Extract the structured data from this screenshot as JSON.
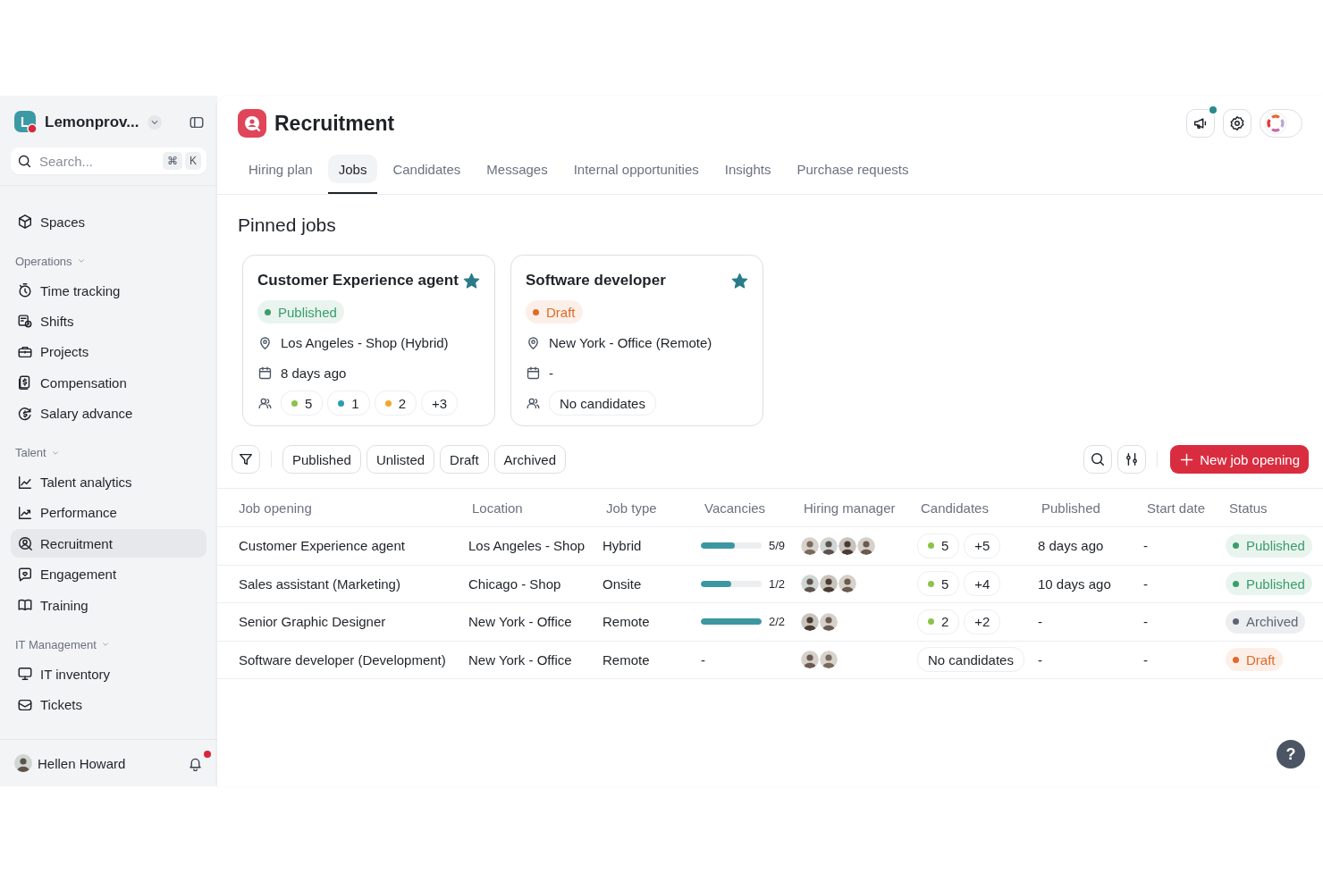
{
  "sidebar": {
    "org": {
      "name": "Lemonprov..."
    },
    "search": {
      "placeholder": "Search...",
      "keys": [
        "⌘",
        "K"
      ]
    },
    "items": [
      {
        "label": "Spaces",
        "selected": false
      }
    ],
    "sections": [
      {
        "title": "Operations",
        "items": [
          {
            "label": "Time tracking",
            "selected": false
          },
          {
            "label": "Shifts",
            "selected": false
          },
          {
            "label": "Projects",
            "selected": false
          },
          {
            "label": "Compensation",
            "selected": false
          },
          {
            "label": "Salary advance",
            "selected": false
          }
        ]
      },
      {
        "title": "Talent",
        "items": [
          {
            "label": "Talent analytics",
            "selected": false
          },
          {
            "label": "Performance",
            "selected": false
          },
          {
            "label": "Recruitment",
            "selected": true
          },
          {
            "label": "Engagement",
            "selected": false
          },
          {
            "label": "Training",
            "selected": false
          }
        ]
      },
      {
        "title": "IT Management",
        "items": [
          {
            "label": "IT inventory",
            "selected": false
          },
          {
            "label": "Tickets",
            "selected": false
          }
        ]
      }
    ],
    "user": {
      "name": "Hellen Howard",
      "has_notification": true
    }
  },
  "header": {
    "title": "Recruitment",
    "announcements_notification": true
  },
  "tabs": [
    {
      "label": "Hiring plan",
      "selected": false
    },
    {
      "label": "Jobs",
      "selected": true
    },
    {
      "label": "Candidates",
      "selected": false
    },
    {
      "label": "Messages",
      "selected": false
    },
    {
      "label": "Internal opportunities",
      "selected": false
    },
    {
      "label": "Insights",
      "selected": false
    },
    {
      "label": "Purchase requests",
      "selected": false
    }
  ],
  "pinned": {
    "title": "Pinned jobs",
    "cards": [
      {
        "title": "Customer Experience agent",
        "pinned": true,
        "status": {
          "label": "Published",
          "color": "#3a9e6a"
        },
        "location": "Los Angeles - Shop (Hybrid)",
        "date": "8 days ago",
        "candidates": [
          {
            "label": "5",
            "color": "#8bc34a"
          },
          {
            "label": "1",
            "color": "#2a9db0"
          },
          {
            "label": "2",
            "color": "#f0a830"
          },
          {
            "label": "+3"
          }
        ]
      },
      {
        "title": "Software developer",
        "pinned": true,
        "status": {
          "label": "Draft",
          "color": "#e06a2a"
        },
        "location": "New York - Office (Remote)",
        "date": "-",
        "candidates": [
          {
            "label": "No candidates"
          }
        ]
      }
    ]
  },
  "filters": [
    "Published",
    "Unlisted",
    "Draft",
    "Archived"
  ],
  "new_job_button": "New job opening",
  "table": {
    "columns": [
      "Job opening",
      "Location",
      "Job type",
      "Vacancies",
      "Hiring manager",
      "Candidates",
      "Published",
      "Start date",
      "Status"
    ],
    "rows": [
      {
        "job": "Customer Experience agent",
        "location": "Los Angeles - Shop",
        "job_type": "Hybrid",
        "vacancies": {
          "level": 0.56,
          "reading": "5/9"
        },
        "managers": [
          {
            "kind": "picture"
          },
          {
            "kind": "picture"
          },
          {
            "kind": "picture"
          },
          {
            "kind": "picture"
          }
        ],
        "candidates": [
          {
            "label": "5",
            "color": "#8bc34a"
          },
          {
            "label": "+5"
          }
        ],
        "published": "8 days ago",
        "start_date": "-",
        "status": {
          "label": "Published",
          "color": "#3a9e6a"
        }
      },
      {
        "job": "Sales assistant (Marketing)",
        "location": "Chicago - Shop",
        "job_type": "Onsite",
        "vacancies": {
          "level": 0.5,
          "reading": "1/2"
        },
        "managers": [
          {
            "kind": "picture"
          },
          {
            "kind": "picture"
          },
          {
            "kind": "picture"
          }
        ],
        "candidates": [
          {
            "label": "5",
            "color": "#8bc34a"
          },
          {
            "label": "+4"
          }
        ],
        "published": "10 days ago",
        "start_date": "-",
        "status": {
          "label": "Published",
          "color": "#3a9e6a"
        }
      },
      {
        "job": "Senior Graphic Designer",
        "location": "New York - Office",
        "job_type": "Remote",
        "vacancies": {
          "level": 1,
          "reading": "2/2"
        },
        "managers": [
          {
            "kind": "picture"
          },
          {
            "kind": "picture"
          }
        ],
        "candidates": [
          {
            "label": "2",
            "color": "#8bc34a"
          },
          {
            "label": "+2"
          }
        ],
        "published": "-",
        "start_date": "-",
        "status": {
          "label": "Archived",
          "color": "#5f6577"
        }
      },
      {
        "job": "Software developer (Development)",
        "location": "New York - Office",
        "job_type": "Remote",
        "vacancies": {
          "reading": "-"
        },
        "managers": [
          {
            "kind": "picture"
          },
          {
            "kind": "picture"
          }
        ],
        "candidates": [
          {
            "label": "No candidates"
          }
        ],
        "published": "-",
        "start_date": "-",
        "status": {
          "label": "Draft",
          "color": "#e06a2a"
        }
      }
    ]
  },
  "help": "?"
}
